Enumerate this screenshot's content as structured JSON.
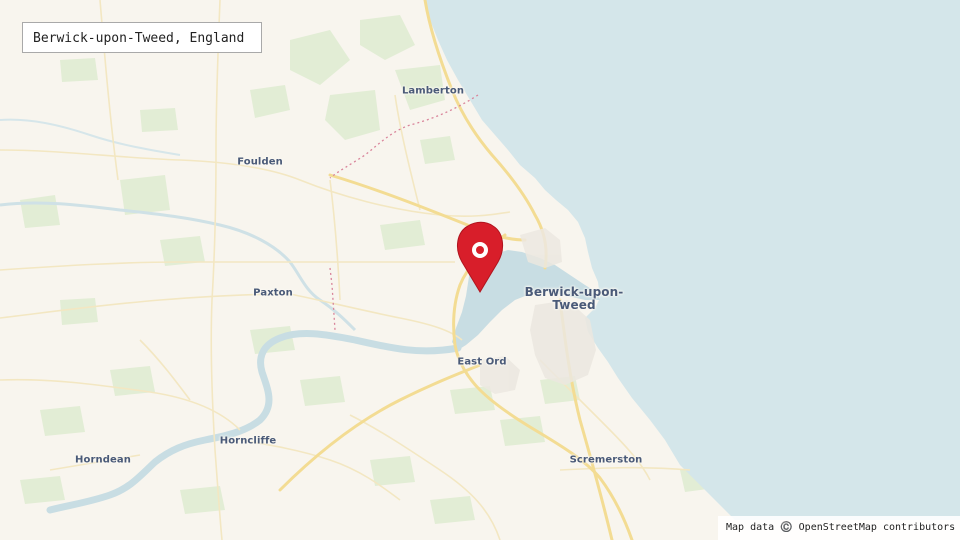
{
  "map": {
    "title": "Berwick-upon-Tweed, England",
    "attribution": "Map data ©️ OpenStreetMap contributors",
    "colors": {
      "land": "#f8f5ee",
      "sea": "#d4e6ea",
      "river": "#c8dde3",
      "road_major": "#f3dc93",
      "road_minor": "#f5ebc9",
      "woodland": "#e0ecd3",
      "label": "#4a5a78",
      "marker": "#d81e2a",
      "boundary": "#d87f93"
    },
    "places": [
      {
        "id": "lamberton",
        "name": "Lamberton"
      },
      {
        "id": "foulden",
        "name": "Foulden"
      },
      {
        "id": "paxton",
        "name": "Paxton"
      },
      {
        "id": "east-ord",
        "name": "East Ord"
      },
      {
        "id": "horncliffe",
        "name": "Horncliffe"
      },
      {
        "id": "horndean",
        "name": "Horndean"
      },
      {
        "id": "scremerston",
        "name": "Scremerston"
      },
      {
        "id": "berwick",
        "name_line1": "Berwick-upon-",
        "name_line2": "Tweed"
      }
    ],
    "marker_icon": "map-pin-icon"
  }
}
